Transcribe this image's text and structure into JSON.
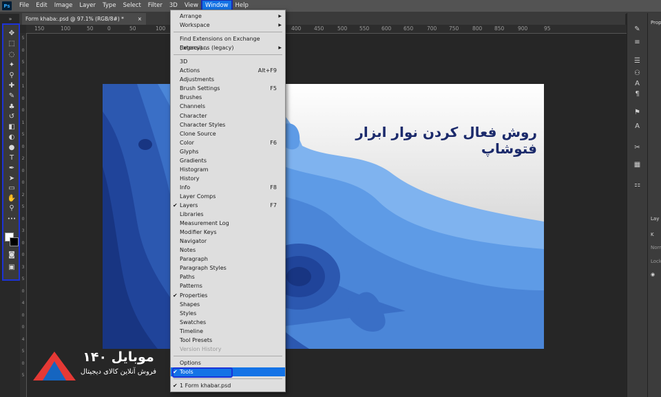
{
  "app": {
    "logo": "Ps"
  },
  "menubar": [
    "File",
    "Edit",
    "Image",
    "Layer",
    "Type",
    "Select",
    "Filter",
    "3D",
    "View",
    "Window",
    "Help"
  ],
  "menubar_active": "Window",
  "document_tab": {
    "title": "Form khaba:.psd @ 97.1% (RGB/8#) *",
    "close": "×"
  },
  "collapse_glyph": "»",
  "ruler_top": [
    "150",
    "100",
    "50",
    "0",
    "50",
    "100",
    "150",
    "400",
    "450",
    "500",
    "550",
    "600",
    "650",
    "700",
    "750",
    "800",
    "850",
    "900",
    "95"
  ],
  "ruler_left": [
    "5",
    "0",
    "5",
    "0",
    "1",
    "0",
    "0",
    "1",
    "5",
    "0",
    "2",
    "0",
    "0",
    "2",
    "5",
    "0",
    "3",
    "0",
    "0",
    "3",
    "5",
    "0",
    "4",
    "0",
    "0",
    "4",
    "5",
    "0",
    "5"
  ],
  "window_menu": {
    "items": [
      {
        "label": "Arrange",
        "shortcut": "",
        "submenu": true,
        "checked": false,
        "disabled": false
      },
      {
        "label": "Workspace",
        "shortcut": "",
        "submenu": true,
        "checked": false,
        "disabled": false
      },
      {
        "sep": true
      },
      {
        "label": "Find Extensions on Exchange (legacy)...",
        "shortcut": "",
        "submenu": false,
        "checked": false,
        "disabled": false
      },
      {
        "label": "Extensions (legacy)",
        "shortcut": "",
        "submenu": true,
        "checked": false,
        "disabled": false
      },
      {
        "sep": true
      },
      {
        "label": "3D",
        "shortcut": "",
        "submenu": false,
        "checked": false,
        "disabled": false
      },
      {
        "label": "Actions",
        "shortcut": "Alt+F9",
        "submenu": false,
        "checked": false,
        "disabled": false
      },
      {
        "label": "Adjustments",
        "shortcut": "",
        "submenu": false,
        "checked": false,
        "disabled": false
      },
      {
        "label": "Brush Settings",
        "shortcut": "F5",
        "submenu": false,
        "checked": false,
        "disabled": false
      },
      {
        "label": "Brushes",
        "shortcut": "",
        "submenu": false,
        "checked": false,
        "disabled": false
      },
      {
        "label": "Channels",
        "shortcut": "",
        "submenu": false,
        "checked": false,
        "disabled": false
      },
      {
        "label": "Character",
        "shortcut": "",
        "submenu": false,
        "checked": false,
        "disabled": false
      },
      {
        "label": "Character Styles",
        "shortcut": "",
        "submenu": false,
        "checked": false,
        "disabled": false
      },
      {
        "label": "Clone Source",
        "shortcut": "",
        "submenu": false,
        "checked": false,
        "disabled": false
      },
      {
        "label": "Color",
        "shortcut": "F6",
        "submenu": false,
        "checked": false,
        "disabled": false
      },
      {
        "label": "Glyphs",
        "shortcut": "",
        "submenu": false,
        "checked": false,
        "disabled": false
      },
      {
        "label": "Gradients",
        "shortcut": "",
        "submenu": false,
        "checked": false,
        "disabled": false
      },
      {
        "label": "Histogram",
        "shortcut": "",
        "submenu": false,
        "checked": false,
        "disabled": false
      },
      {
        "label": "History",
        "shortcut": "",
        "submenu": false,
        "checked": false,
        "disabled": false
      },
      {
        "label": "Info",
        "shortcut": "F8",
        "submenu": false,
        "checked": false,
        "disabled": false
      },
      {
        "label": "Layer Comps",
        "shortcut": "",
        "submenu": false,
        "checked": false,
        "disabled": false
      },
      {
        "label": "Layers",
        "shortcut": "F7",
        "submenu": false,
        "checked": true,
        "disabled": false
      },
      {
        "label": "Libraries",
        "shortcut": "",
        "submenu": false,
        "checked": false,
        "disabled": false
      },
      {
        "label": "Measurement Log",
        "shortcut": "",
        "submenu": false,
        "checked": false,
        "disabled": false
      },
      {
        "label": "Modifier Keys",
        "shortcut": "",
        "submenu": false,
        "checked": false,
        "disabled": false
      },
      {
        "label": "Navigator",
        "shortcut": "",
        "submenu": false,
        "checked": false,
        "disabled": false
      },
      {
        "label": "Notes",
        "shortcut": "",
        "submenu": false,
        "checked": false,
        "disabled": false
      },
      {
        "label": "Paragraph",
        "shortcut": "",
        "submenu": false,
        "checked": false,
        "disabled": false
      },
      {
        "label": "Paragraph Styles",
        "shortcut": "",
        "submenu": false,
        "checked": false,
        "disabled": false
      },
      {
        "label": "Paths",
        "shortcut": "",
        "submenu": false,
        "checked": false,
        "disabled": false
      },
      {
        "label": "Patterns",
        "shortcut": "",
        "submenu": false,
        "checked": false,
        "disabled": false
      },
      {
        "label": "Properties",
        "shortcut": "",
        "submenu": false,
        "checked": true,
        "disabled": false
      },
      {
        "label": "Shapes",
        "shortcut": "",
        "submenu": false,
        "checked": false,
        "disabled": false
      },
      {
        "label": "Styles",
        "shortcut": "",
        "submenu": false,
        "checked": false,
        "disabled": false
      },
      {
        "label": "Swatches",
        "shortcut": "",
        "submenu": false,
        "checked": false,
        "disabled": false
      },
      {
        "label": "Timeline",
        "shortcut": "",
        "submenu": false,
        "checked": false,
        "disabled": false
      },
      {
        "label": "Tool Presets",
        "shortcut": "",
        "submenu": false,
        "checked": false,
        "disabled": false
      },
      {
        "label": "Version History",
        "shortcut": "",
        "submenu": false,
        "checked": false,
        "disabled": true
      },
      {
        "sep": true
      },
      {
        "label": "Options",
        "shortcut": "",
        "submenu": false,
        "checked": false,
        "disabled": false
      },
      {
        "label": "Tools",
        "shortcut": "",
        "submenu": false,
        "checked": true,
        "disabled": false,
        "highlight": true
      },
      {
        "sep": true
      },
      {
        "label": "1 Form khabar.psd",
        "shortcut": "",
        "submenu": false,
        "checked": true,
        "disabled": false
      }
    ]
  },
  "toolbar": [
    {
      "name": "move-tool",
      "glyph": "✥"
    },
    {
      "name": "marquee-tool",
      "glyph": "⬚"
    },
    {
      "name": "lasso-tool",
      "glyph": "◌"
    },
    {
      "name": "magic-wand-tool",
      "glyph": "✦"
    },
    {
      "name": "eyedropper-tool",
      "glyph": "⚲"
    },
    {
      "name": "healing-brush-tool",
      "glyph": "✚"
    },
    {
      "name": "brush-tool",
      "glyph": "✎"
    },
    {
      "name": "clone-stamp-tool",
      "glyph": "♣"
    },
    {
      "name": "history-brush-tool",
      "glyph": "↺"
    },
    {
      "name": "eraser-tool",
      "glyph": "◧"
    },
    {
      "name": "gradient-tool",
      "glyph": "◐"
    },
    {
      "name": "blur-tool",
      "glyph": "●"
    },
    {
      "name": "type-tool",
      "glyph": "T"
    },
    {
      "name": "pen-tool",
      "glyph": "✒"
    },
    {
      "name": "path-selection-tool",
      "glyph": "➤"
    },
    {
      "name": "rectangle-tool",
      "glyph": "▭"
    },
    {
      "name": "hand-tool",
      "glyph": "✋"
    },
    {
      "name": "zoom-tool",
      "glyph": "⚲"
    },
    {
      "name": "more-tools",
      "glyph": "•••"
    }
  ],
  "toolbar_bottom": [
    {
      "name": "quick-mask-icon",
      "glyph": "◙"
    },
    {
      "name": "screen-mode-icon",
      "glyph": "▣"
    }
  ],
  "icon_strip": [
    {
      "name": "brush-settings-icon",
      "glyph": "✎"
    },
    {
      "name": "adjust-sliders-icon",
      "glyph": "≡"
    },
    {
      "name": "libraries-icon",
      "glyph": "☰"
    },
    {
      "name": "clone-source-icon",
      "glyph": "⚇"
    },
    {
      "name": "character-icon",
      "glyph": "A"
    },
    {
      "name": "paragraph-icon",
      "glyph": "¶"
    },
    {
      "name": "character-styles-icon",
      "glyph": "⚑"
    },
    {
      "name": "paragraph-styles-icon",
      "glyph": "A"
    },
    {
      "name": "tools-icon",
      "glyph": "✂"
    },
    {
      "name": "patterns-icon",
      "glyph": "▦"
    },
    {
      "name": "layer-comps-icon",
      "glyph": "⚏"
    }
  ],
  "right_panel": {
    "properties_tab": "Prop",
    "layers_tab": "Lay",
    "search_placeholder": "K",
    "normal_mode": "Norm",
    "lock_label": "Lock"
  },
  "canvas": {
    "title": "روش فعال کردن نوار ابزار فتوشاپ"
  },
  "watermark": {
    "brand": "موبایل ۱۴۰",
    "tagline": "فروش آنلاین کالای دیجیتال"
  },
  "colors": {
    "accent": "#1473e6",
    "outline": "#1c33d8"
  }
}
